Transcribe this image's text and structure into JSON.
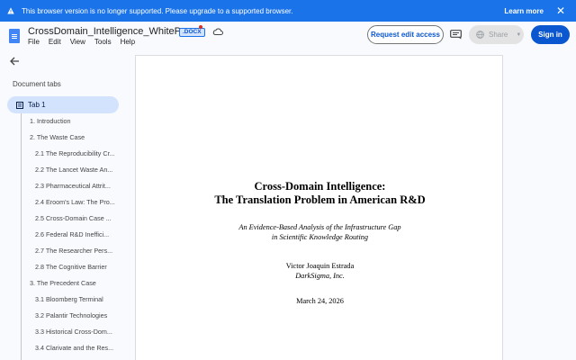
{
  "banner": {
    "message": "This browser version is no longer supported. Please upgrade to a supported browser.",
    "learn_more": "Learn more",
    "close": "✕"
  },
  "header": {
    "doc_title": "CrossDomain_Intelligence_WhitePaper",
    "badge": ".DOCX",
    "menu": [
      "File",
      "Edit",
      "View",
      "Tools",
      "Help"
    ],
    "request_edit": "Request edit access",
    "share": "Share",
    "sign_in": "Sign in"
  },
  "sidebar": {
    "heading": "Document tabs",
    "active_tab": "Tab 1",
    "outline": [
      {
        "label": "1. Introduction",
        "level": 1
      },
      {
        "label": "2. The Waste Case",
        "level": 1
      },
      {
        "label": "2.1 The Reproducibility Cr...",
        "level": 2
      },
      {
        "label": "2.2 The Lancet Waste An...",
        "level": 2
      },
      {
        "label": "2.3 Pharmaceutical Attrit...",
        "level": 2
      },
      {
        "label": "2.4 Eroom's Law: The Pro...",
        "level": 2
      },
      {
        "label": "2.5 Cross-Domain Case ...",
        "level": 2
      },
      {
        "label": "2.6 Federal R&D Ineffici...",
        "level": 2
      },
      {
        "label": "2.7 The Researcher Pers...",
        "level": 2
      },
      {
        "label": "2.8 The Cognitive Barrier",
        "level": 2
      },
      {
        "label": "3. The Precedent Case",
        "level": 1
      },
      {
        "label": "3.1 Bloomberg Terminal",
        "level": 2
      },
      {
        "label": "3.2 Palantir Technologies",
        "level": 2
      },
      {
        "label": "3.3 Historical Cross-Dom...",
        "level": 2
      },
      {
        "label": "3.4 Clarivate and the Res...",
        "level": 2
      }
    ]
  },
  "document": {
    "title_line1": "Cross-Domain Intelligence:",
    "title_line2": "The Translation Problem in American R&D",
    "subtitle_line1": "An Evidence-Based Analysis of the Infrastructure Gap",
    "subtitle_line2": "in Scientific Knowledge Routing",
    "author": "Victor Joaquin Estrada",
    "organization": "DarkSigma, Inc.",
    "date": "March 24, 2026"
  },
  "colors": {
    "banner": "#1a73e8",
    "primary": "#0b57d0",
    "active_tab": "#d3e3fd",
    "doc_icon": "#4285f4"
  },
  "icons": [
    "warning-icon",
    "close-icon",
    "docs-icon",
    "cloud-status-icon",
    "comment-icon",
    "globe-icon",
    "back-arrow-icon",
    "tab-icon"
  ]
}
